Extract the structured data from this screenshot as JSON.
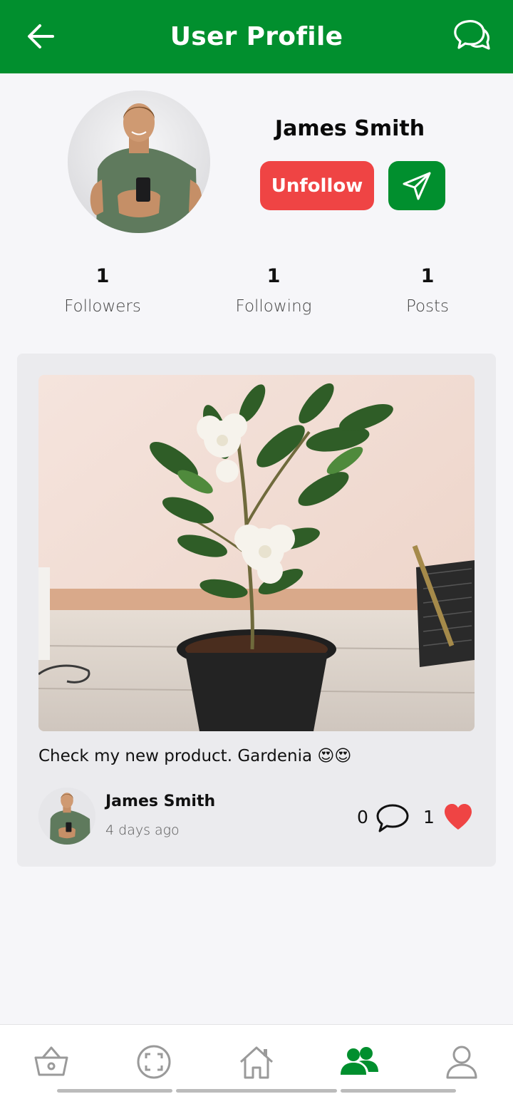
{
  "header": {
    "title": "User Profile"
  },
  "profile": {
    "name": "James Smith",
    "unfollow_label": "Unfollow",
    "stats": [
      {
        "value": "1",
        "label": "Followers"
      },
      {
        "value": "1",
        "label": "Following"
      },
      {
        "value": "1",
        "label": "Posts"
      }
    ]
  },
  "post": {
    "caption": "Check my new product. Gardenia 😍😍",
    "author": "James Smith",
    "time_ago": "4 days ago",
    "comments": "0",
    "likes": "1"
  },
  "nav": {
    "items": [
      "basket-icon",
      "scan-icon",
      "home-icon",
      "community-icon",
      "user-icon"
    ],
    "active": "community-icon"
  },
  "colors": {
    "brand": "#018f2e",
    "unfollow": "#ef4444",
    "heart": "#ef4444"
  }
}
